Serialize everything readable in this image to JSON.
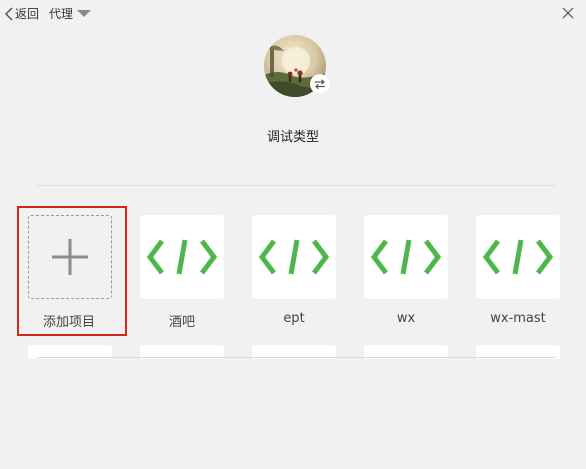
{
  "topbar": {
    "back_label": "返回",
    "proxy_label": "代理"
  },
  "profile": {
    "title": "调试类型"
  },
  "projects": {
    "add_label": "添加项目",
    "items": [
      {
        "label": "酒吧",
        "icon": "code-icon"
      },
      {
        "label": "ept",
        "icon": "code-icon"
      },
      {
        "label": "wx",
        "icon": "code-icon"
      },
      {
        "label": "wx-mast",
        "icon": "code-icon"
      }
    ]
  },
  "colors": {
    "background": "#f1f1f1",
    "accent_green": "#4db84a",
    "selection_red": "#d9261c"
  }
}
